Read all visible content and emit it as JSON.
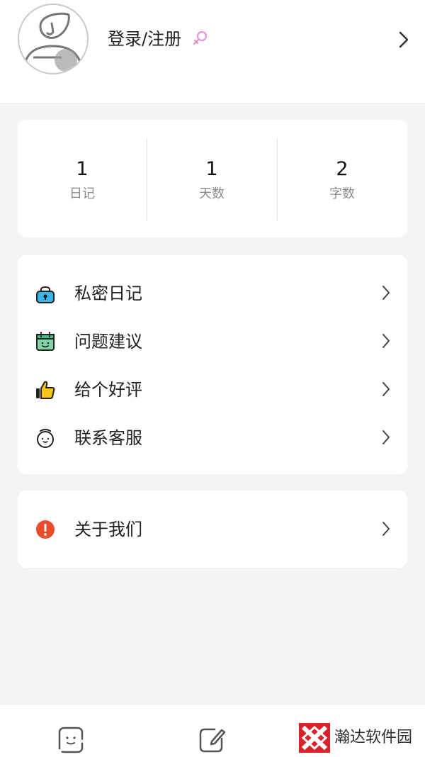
{
  "header": {
    "login_label": "登录/注册",
    "avatar_icon": "default-avatar-icon",
    "gender_icon": "female-icon"
  },
  "stats": [
    {
      "value": "1",
      "label": "日记"
    },
    {
      "value": "1",
      "label": "天数"
    },
    {
      "value": "2",
      "label": "字数"
    }
  ],
  "menu": {
    "items": [
      {
        "label": "私密日记",
        "icon": "lock-icon"
      },
      {
        "label": "问题建议",
        "icon": "calendar-smile-icon"
      },
      {
        "label": "给个好评",
        "icon": "thumbs-up-icon"
      },
      {
        "label": "联系客服",
        "icon": "alarm-clock-icon"
      }
    ]
  },
  "about": {
    "label": "关于我们",
    "icon": "alert-icon"
  },
  "tabbar": {
    "tabs": [
      {
        "icon": "diary-list-icon"
      },
      {
        "icon": "compose-icon"
      }
    ]
  },
  "watermark": {
    "text": "瀚达软件园"
  },
  "colors": {
    "accent_pink": "#e78bd0",
    "lock_blue": "#3db4e8",
    "calendar_green": "#3fbf8a",
    "thumb_yellow": "#f5c518",
    "alert_red": "#ea4d2c",
    "background": "#f4f4f4"
  }
}
